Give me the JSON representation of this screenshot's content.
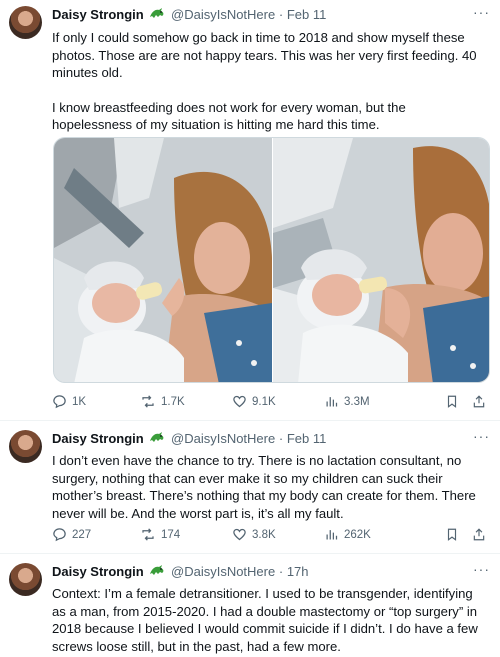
{
  "tweets": [
    {
      "name": "Daisy Strongin",
      "handle": "@DaisyIsNotHere",
      "dot": "·",
      "time": "Feb 11",
      "paragraphs": [
        "If only I could somehow go back in time to 2018 and show myself these photos. Those are are not happy tears. This was her very first feeding. 40 minutes old.",
        "I know breastfeeding does not work for every woman, but the hopelessness of my situation is hitting me hard this time."
      ],
      "stats": {
        "replies": "1K",
        "reposts": "1.7K",
        "likes": "9.1K",
        "views": "3.3M"
      }
    },
    {
      "name": "Daisy Strongin",
      "handle": "@DaisyIsNotHere",
      "dot": "·",
      "time": "Feb 11",
      "paragraphs": [
        "I don’t even have the chance to try. There is no lactation consultant, no surgery, nothing that can ever make it so my children can suck their mother’s breast. There’s nothing that my body can create for them. There never will be. And the worst part is, it’s all my fault."
      ],
      "stats": {
        "replies": "227",
        "reposts": "174",
        "likes": "3.8K",
        "views": "262K"
      }
    },
    {
      "name": "Daisy Strongin",
      "handle": "@DaisyIsNotHere",
      "dot": "·",
      "time": "17h",
      "paragraphs": [
        "Context: I’m a female detransitioner. I used to be transgender, identifying as a man, from 2015-2020. I had a double mastectomy or “top surgery” in 2018 because I believed I would commit suicide if I didn’t. I do have a few screws loose still, but in the past, had a few more."
      ]
    }
  ],
  "more_label": "···",
  "icons": {
    "avatar": "avatar",
    "badge": "dragon-emoji-icon",
    "reply": "reply-icon",
    "repost": "repost-icon",
    "like": "heart-icon",
    "views": "views-icon",
    "bookmark": "bookmark-icon",
    "share": "share-icon"
  },
  "colors": {
    "text": "#0f1419",
    "secondary": "#536471",
    "border": "#eff3f4",
    "badge": "#3a9d3a"
  }
}
